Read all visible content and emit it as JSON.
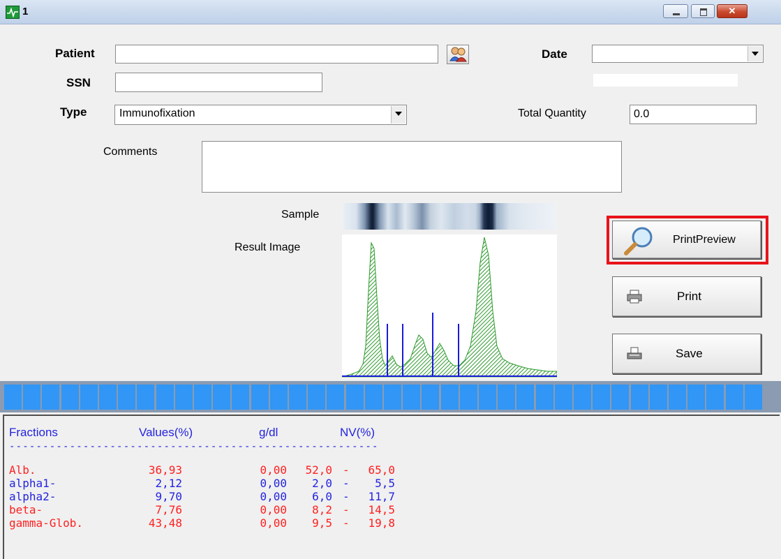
{
  "window": {
    "title": "1",
    "buttons": [
      "minimize",
      "maximize",
      "close"
    ],
    "close_glyph": "✕"
  },
  "form": {
    "patient_label": "Patient",
    "patient_value": "",
    "ssn_label": "SSN",
    "ssn_value": "",
    "date_label": "Date",
    "date_value": "",
    "type_label": "Type",
    "type_value": "Immunofixation",
    "total_quantity_label": "Total Quantity",
    "total_quantity_value": "0.0",
    "comments_label": "Comments",
    "comments_value": "",
    "sample_label": "Sample",
    "result_image_label": "Result Image"
  },
  "buttons": {
    "print_preview": "PrintPreview",
    "print": "Print",
    "save": "Save"
  },
  "results": {
    "headers": {
      "fractions": "Fractions",
      "values": "Values(%)",
      "gdl": "g/dl",
      "nv": "NV(%)"
    },
    "separator": "-------------------------------------------------------",
    "rows": [
      {
        "name": "Alb.",
        "value": "36,93",
        "gdl": "0,00",
        "nv_low": "52,0",
        "nv_high": "65,0",
        "color": "red"
      },
      {
        "name": "alpha1-",
        "value": "2,12",
        "gdl": "0,00",
        "nv_low": "2,0",
        "nv_high": "5,5",
        "color": "blue"
      },
      {
        "name": "alpha2-",
        "value": "9,70",
        "gdl": "0,00",
        "nv_low": "6,0",
        "nv_high": "11,7",
        "color": "blue"
      },
      {
        "name": "beta-",
        "value": "7,76",
        "gdl": "0,00",
        "nv_low": "8,2",
        "nv_high": "14,5",
        "color": "red"
      },
      {
        "name": "gamma-Glob.",
        "value": "43,48",
        "gdl": "0,00",
        "nv_low": "9,5",
        "nv_high": "19,8",
        "color": "red"
      }
    ]
  },
  "colors": {
    "highlight": "#e8141a",
    "curve_fill": "#2f9a2f",
    "marker_lines": "#1a1adc",
    "blue_segments": "#3196f5",
    "out_of_range": "#ff2020",
    "in_range": "#2323e0"
  },
  "icons": {
    "app": "app-icon",
    "patient_lookup": "patient-search-icon",
    "print_preview": "magnifier-icon",
    "print": "printer-icon",
    "save": "save-icon"
  }
}
